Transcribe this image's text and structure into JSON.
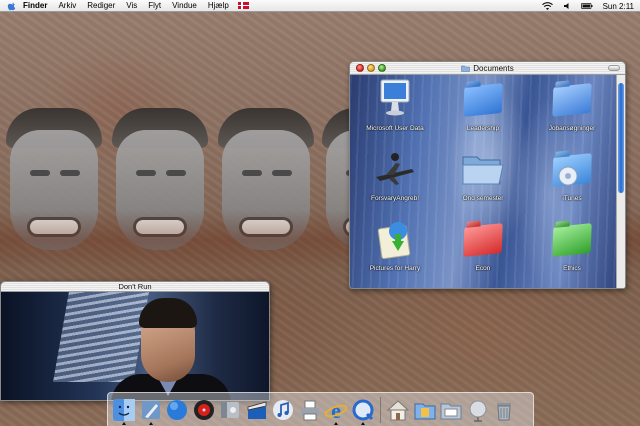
{
  "menubar": {
    "app_name": "Finder",
    "menus": [
      "Arkiv",
      "Rediger",
      "Vis",
      "Flyt",
      "Vindue",
      "Hjælp"
    ],
    "clock": "Sun 2:11",
    "icons": [
      "apple-icon",
      "danish-flag-icon",
      "wifi-icon",
      "volume-icon",
      "battery-icon"
    ]
  },
  "documents_window": {
    "title": "Documents",
    "items": [
      {
        "label": "Microsoft User Data",
        "icon": "imac-icon"
      },
      {
        "label": "Leadership",
        "icon": "blue-folder-icon"
      },
      {
        "label": "Jobansøgninger",
        "icon": "blue-folder-icon"
      },
      {
        "label": "ForsvaryAngreb!",
        "icon": "airplane-icon"
      },
      {
        "label": "Ond semester",
        "icon": "open-folder-icon"
      },
      {
        "label": "iTunes",
        "icon": "itunes-folder-icon"
      },
      {
        "label": "Pictures for Harry",
        "icon": "download-folder-icon"
      },
      {
        "label": "Econ",
        "icon": "red-folder-icon"
      },
      {
        "label": "Ethics",
        "icon": "green-folder-icon"
      }
    ]
  },
  "movie_window": {
    "title": "Don't Run"
  },
  "dock": {
    "items": [
      {
        "name": "Finder",
        "icon": "finder-icon",
        "running": true
      },
      {
        "name": "Mail",
        "icon": "mail-icon",
        "running": true
      },
      {
        "name": "Internet Connect",
        "icon": "globe-icon",
        "running": false
      },
      {
        "name": "DVD Player",
        "icon": "dvd-icon",
        "running": false
      },
      {
        "name": "System Preferences",
        "icon": "system-preferences-icon",
        "running": false
      },
      {
        "name": "iMovie",
        "icon": "clapper-icon",
        "running": false
      },
      {
        "name": "iTunes",
        "icon": "itunes-icon",
        "running": false
      },
      {
        "name": "Print Center",
        "icon": "printer-icon",
        "running": false
      },
      {
        "name": "Internet Explorer",
        "icon": "ie-icon",
        "running": true
      },
      {
        "name": "QuickTime Player",
        "icon": "quicktime-icon",
        "running": true
      },
      {
        "name": "Home",
        "icon": "home-icon",
        "running": false
      },
      {
        "name": "Documents",
        "icon": "documents-folder-icon",
        "running": false
      },
      {
        "name": "Mail Folder",
        "icon": "mail-folder-icon",
        "running": false
      },
      {
        "name": "Network",
        "icon": "network-icon",
        "running": false
      },
      {
        "name": "Trash",
        "icon": "trash-icon",
        "running": false
      }
    ]
  },
  "colors": {
    "selection_blue": "#2a6acc",
    "close_red": "#d8241c",
    "minimize_yellow": "#e09b12",
    "zoom_green": "#3a9d1c"
  }
}
